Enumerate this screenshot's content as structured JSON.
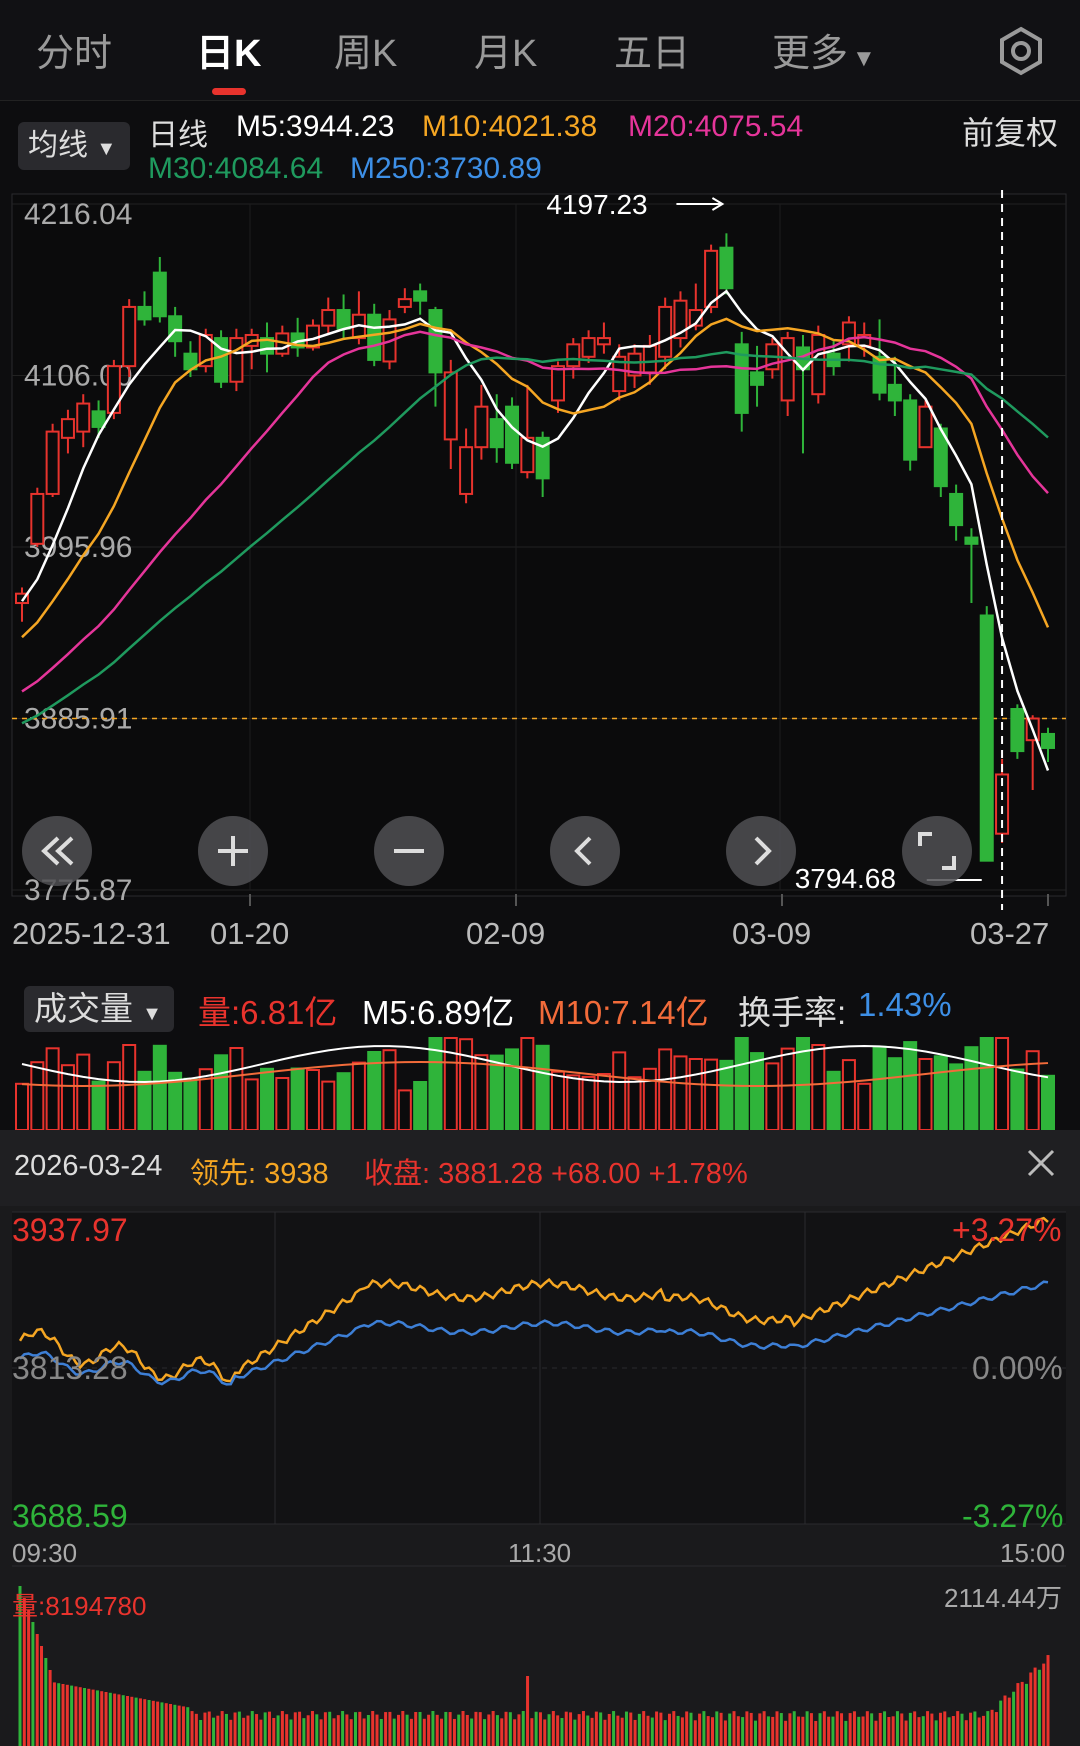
{
  "tabs": [
    {
      "label": "分时",
      "active": false
    },
    {
      "label": "日K",
      "active": true
    },
    {
      "label": "周K",
      "active": false
    },
    {
      "label": "月K",
      "active": false
    },
    {
      "label": "五日",
      "active": false
    },
    {
      "label": "更多",
      "active": false
    }
  ],
  "header": {
    "ma_select": "均线",
    "period": "日线",
    "m5": "M5:3944.23",
    "m10": "M10:4021.38",
    "m20": "M20:4075.54",
    "m30": "M30:4084.64",
    "m250": "M250:3730.89",
    "adjust": "前复权"
  },
  "colors": {
    "up": "#e8332d",
    "down": "#2fb43a",
    "ma5": "#ffffff",
    "ma10": "#f5a623",
    "ma20": "#e5359a",
    "ma30": "#1f9a5e",
    "ma250": "#3d8fe6",
    "lead": "#f5a623",
    "close_line": "#3d7fd6"
  },
  "chart_data": [
    {
      "type": "candlestick",
      "ylim": [
        3775.87,
        4216.04
      ],
      "y_ticks": [
        "4216.04",
        "4106.00",
        "3995.96",
        "3885.91",
        "3775.87"
      ],
      "x_ticks": [
        "2025-12-31",
        "01-20",
        "02-09",
        "03-09",
        "03-27"
      ],
      "high_marker": "4197.23",
      "low_marker": "3794.68",
      "last_close_line": 3885.91,
      "candles": [
        [
          3960,
          3966,
          3948,
          3970
        ],
        [
          3998,
          4030,
          3996,
          4034
        ],
        [
          4030,
          4070,
          4028,
          4075
        ],
        [
          4066,
          4078,
          4056,
          4084
        ],
        [
          4070,
          4088,
          4060,
          4094
        ],
        [
          4083,
          4073,
          4066,
          4090
        ],
        [
          4082,
          4112,
          4078,
          4116
        ],
        [
          4112,
          4150,
          4105,
          4155
        ],
        [
          4150,
          4142,
          4138,
          4160
        ],
        [
          4172,
          4144,
          4140,
          4182
        ],
        [
          4144,
          4128,
          4118,
          4150
        ],
        [
          4120,
          4110,
          4105,
          4128
        ],
        [
          4112,
          4132,
          4108,
          4136
        ],
        [
          4130,
          4102,
          4098,
          4135
        ],
        [
          4102,
          4130,
          4096,
          4136
        ],
        [
          4125,
          4132,
          4110,
          4136
        ],
        [
          4130,
          4120,
          4108,
          4140
        ],
        [
          4120,
          4133,
          4118,
          4138
        ],
        [
          4133,
          4124,
          4118,
          4143
        ],
        [
          4124,
          4138,
          4122,
          4142
        ],
        [
          4138,
          4148,
          4132,
          4156
        ],
        [
          4148,
          4136,
          4130,
          4158
        ],
        [
          4130,
          4145,
          4126,
          4160
        ],
        [
          4145,
          4116,
          4112,
          4152
        ],
        [
          4115,
          4142,
          4110,
          4148
        ],
        [
          4150,
          4155,
          4146,
          4162
        ],
        [
          4160,
          4154,
          4145,
          4165
        ],
        [
          4148,
          4108,
          4086,
          4150
        ],
        [
          4065,
          4108,
          4046,
          4116
        ],
        [
          4030,
          4060,
          4024,
          4072
        ],
        [
          4060,
          4086,
          4052,
          4100
        ],
        [
          4078,
          4060,
          4050,
          4094
        ],
        [
          4086,
          4050,
          4046,
          4092
        ],
        [
          4044,
          4066,
          4040,
          4100
        ],
        [
          4066,
          4040,
          4028,
          4070
        ],
        [
          4090,
          4112,
          4082,
          4115
        ],
        [
          4112,
          4126,
          4104,
          4130
        ],
        [
          4118,
          4130,
          4114,
          4135
        ],
        [
          4126,
          4130,
          4120,
          4140
        ],
        [
          4096,
          4118,
          4090,
          4126
        ],
        [
          4106,
          4120,
          4098,
          4126
        ],
        [
          4108,
          4125,
          4100,
          4132
        ],
        [
          4118,
          4150,
          4110,
          4156
        ],
        [
          4130,
          4154,
          4124,
          4160
        ],
        [
          4138,
          4148,
          4135,
          4165
        ],
        [
          4150,
          4186,
          4146,
          4190
        ],
        [
          4188,
          4162,
          4158,
          4197.23
        ],
        [
          4126,
          4082,
          4070,
          4134
        ],
        [
          4108,
          4100,
          4086,
          4125
        ],
        [
          4110,
          4126,
          4104,
          4130
        ],
        [
          4090,
          4130,
          4080,
          4134
        ],
        [
          4124,
          4110,
          4056,
          4132
        ],
        [
          4094,
          4132,
          4088,
          4138
        ],
        [
          4120,
          4112,
          4106,
          4128
        ],
        [
          4126,
          4140,
          4115,
          4144
        ],
        [
          4125,
          4132,
          4118,
          4140
        ],
        [
          4118,
          4095,
          4090,
          4142
        ],
        [
          4100,
          4090,
          4080,
          4118
        ],
        [
          4090,
          4052,
          4045,
          4094
        ],
        [
          4060,
          4086,
          4060,
          4090
        ],
        [
          4072,
          4035,
          4028,
          4075
        ],
        [
          4030,
          4010,
          4000,
          4036
        ],
        [
          4002,
          3998,
          3960,
          4008
        ],
        [
          3952,
          3794.68,
          3794.68,
          3958
        ],
        [
          3812,
          3850,
          3806,
          3860
        ],
        [
          3892,
          3865,
          3860,
          3895
        ],
        [
          3872,
          3885.91,
          3840,
          3888
        ],
        [
          3876,
          3867,
          3858,
          3880
        ]
      ],
      "ma5_label": "M5",
      "ma10_label": "M10",
      "ma20_label": "M20",
      "ma30_label": "M30"
    }
  ],
  "volume": {
    "select": "成交量",
    "vol": "量:6.81亿",
    "m5": "M5:6.89亿",
    "m10": "M10:7.14亿",
    "turnover_label": "换手率:",
    "turnover": "1.43%"
  },
  "intraday": {
    "date": "2026-03-24",
    "lead": "领先: 3938",
    "close": "收盘: 3881.28 +68.00 +1.78%",
    "high": "3937.97",
    "base": "3813.28",
    "low": "3688.59",
    "pct_high": "+3.27%",
    "pct_base": "0.00%",
    "pct_low": "-3.27%",
    "t_start": "09:30",
    "t_mid": "11:30",
    "t_end": "15:00",
    "vol_label": "量:8194780",
    "vol_max": "2114.44万"
  }
}
